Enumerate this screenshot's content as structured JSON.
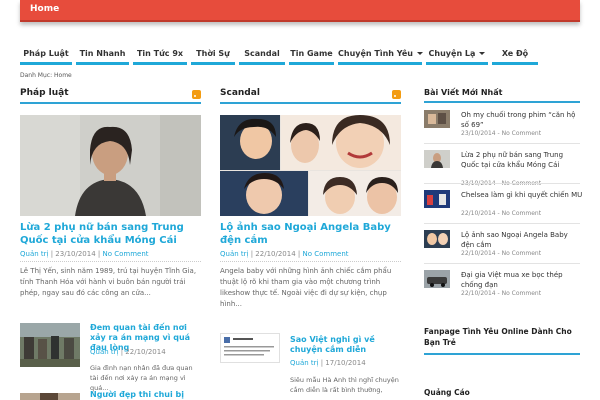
{
  "top": {
    "home_label": "Home"
  },
  "nav": {
    "items": [
      {
        "label": "Pháp Luật"
      },
      {
        "label": "Tin Nhanh"
      },
      {
        "label": "Tin Tức 9x"
      },
      {
        "label": "Thời Sự"
      },
      {
        "label": "Scandal"
      },
      {
        "label": "Tin Game"
      },
      {
        "label": "Chuyện Tình Yêu"
      },
      {
        "label": "Chuyện Lạ"
      },
      {
        "label": "Xe Độ"
      }
    ]
  },
  "breadcrumb": {
    "text": "Danh Mục: Home"
  },
  "col1": {
    "title": "Pháp luật",
    "main": {
      "headline": "Lừa 2 phụ nữ bán sang Trung Quốc tại cửa khẩu Móng Cái",
      "author": "Quản trị",
      "date": "23/10/2014",
      "comments": "No Comment",
      "excerpt": "Lê Thị Yến, sinh năm 1989, trú tại huyện Tĩnh Gia, tỉnh Thanh Hóa với hành vi buôn bán người trái phép, ngay sau đó các công an cửa..."
    },
    "small1": {
      "title": "Đem quan tài đến nơi xảy ra án mạng vì quá đau lòng",
      "author": "Quản trị",
      "date": "22/10/2014",
      "excerpt": "Gia đình nạn nhân đã đưa quan tài đến nơi xảy ra án mạng vì quá..."
    },
    "small2": {
      "title": "Người đẹp thi chui bị phạt"
    }
  },
  "col2": {
    "title": "Scandal",
    "main": {
      "headline": "Lộ ảnh sao Ngoại Angela Baby đện cắm",
      "author": "Quản trị",
      "date": "22/10/2014",
      "comments": "No Comment",
      "excerpt": "Angela baby với những hình ảnh chiếc cắm phẩu thuật lộ rõ khi tham gia vào một chương trình likeshow thực tế. Ngoài việc đi dự sự kiện, chụp hình..."
    },
    "small1": {
      "title": "Sao Việt nghi gì về chuyện cắm diễn",
      "author": "Quản trị",
      "date": "17/10/2014",
      "excerpt": "Siêu mẫu Hà Anh thì nghĩ chuyện cắm diễn là rất bình thường,"
    }
  },
  "sidebar": {
    "recent_title": "Bài Viết Mới Nhất",
    "recent": [
      {
        "title": "Oh my chuối trong phim “căn hộ số 69”",
        "date": "23/10/2014",
        "comments": "No Comment"
      },
      {
        "title": "Lừa 2 phụ nữ bán sang Trung Quốc tại cửa khẩu Móng Cái",
        "date": "23/10/2014",
        "comments": "No Comment"
      },
      {
        "title": "Chelsea làm gì khi quyết chiến MU",
        "date": "22/10/2014",
        "comments": "No Comment"
      },
      {
        "title": "Lộ ảnh sao Ngoại Angela Baby đện cắm",
        "date": "22/10/2014",
        "comments": "No Comment"
      },
      {
        "title": "Đại gia Việt mua xe bọc thép chống đạn",
        "date": "22/10/2014",
        "comments": "No Comment"
      }
    ],
    "fanpage_title": "Fanpage Tình Yêu Online Dành Cho Bạn Trẻ",
    "ads_title": "Quảng Cáo"
  },
  "colors": {
    "accent": "#1fa8d8",
    "topbar": "#e74c3c",
    "rss": "#f39c12"
  }
}
